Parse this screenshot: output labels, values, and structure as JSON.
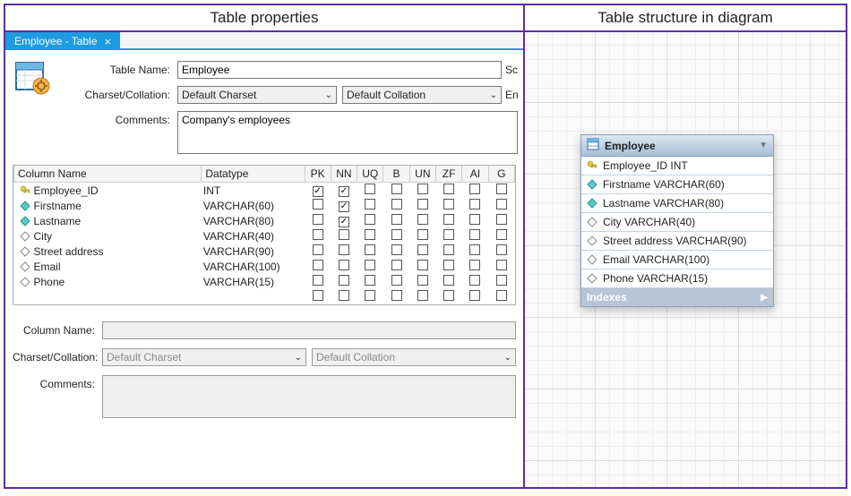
{
  "headings": {
    "left": "Table properties",
    "right": "Table structure in diagram"
  },
  "tab": {
    "label": "Employee - Table"
  },
  "props": {
    "table_name_label": "Table Name:",
    "table_name_value": "Employee",
    "extra1": "Sc",
    "charset_label": "Charset/Collation:",
    "charset_value": "Default Charset",
    "collation_value": "Default Collation",
    "extra2": "En",
    "comments_label": "Comments:",
    "comments_value": "Company's employees"
  },
  "cols": {
    "headers": {
      "name": "Column Name",
      "datatype": "Datatype",
      "pk": "PK",
      "nn": "NN",
      "uq": "UQ",
      "b": "B",
      "un": "UN",
      "zf": "ZF",
      "ai": "AI",
      "g": "G"
    },
    "rows": [
      {
        "icon": "key",
        "name": "Employee_ID",
        "datatype": "INT",
        "pk": true,
        "nn": true,
        "uq": false,
        "b": false,
        "un": false,
        "zf": false,
        "ai": false,
        "g": false
      },
      {
        "icon": "dia-filled",
        "name": "Firstname",
        "datatype": "VARCHAR(60)",
        "pk": false,
        "nn": true,
        "uq": false,
        "b": false,
        "un": false,
        "zf": false,
        "ai": false,
        "g": false
      },
      {
        "icon": "dia-filled",
        "name": "Lastname",
        "datatype": "VARCHAR(80)",
        "pk": false,
        "nn": true,
        "uq": false,
        "b": false,
        "un": false,
        "zf": false,
        "ai": false,
        "g": false
      },
      {
        "icon": "dia-open",
        "name": "City",
        "datatype": "VARCHAR(40)",
        "pk": false,
        "nn": false,
        "uq": false,
        "b": false,
        "un": false,
        "zf": false,
        "ai": false,
        "g": false
      },
      {
        "icon": "dia-open",
        "name": "Street address",
        "datatype": "VARCHAR(90)",
        "pk": false,
        "nn": false,
        "uq": false,
        "b": false,
        "un": false,
        "zf": false,
        "ai": false,
        "g": false
      },
      {
        "icon": "dia-open",
        "name": "Email",
        "datatype": "VARCHAR(100)",
        "pk": false,
        "nn": false,
        "uq": false,
        "b": false,
        "un": false,
        "zf": false,
        "ai": false,
        "g": false
      },
      {
        "icon": "dia-open",
        "name": "Phone",
        "datatype": "VARCHAR(15)",
        "pk": false,
        "nn": false,
        "uq": false,
        "b": false,
        "un": false,
        "zf": false,
        "ai": false,
        "g": false
      }
    ]
  },
  "col_detail": {
    "name_label": "Column Name:",
    "name_value": "",
    "charset_label": "Charset/Collation:",
    "charset_value": "Default Charset",
    "collation_value": "Default Collation",
    "comments_label": "Comments:",
    "comments_value": ""
  },
  "diagram": {
    "title": "Employee",
    "rows": [
      {
        "icon": "key",
        "text": "Employee_ID INT"
      },
      {
        "icon": "dia-filled",
        "text": "Firstname VARCHAR(60)"
      },
      {
        "icon": "dia-filled",
        "text": "Lastname VARCHAR(80)"
      },
      {
        "icon": "dia-open",
        "text": "City VARCHAR(40)"
      },
      {
        "icon": "dia-open",
        "text": "Street address VARCHAR(90)"
      },
      {
        "icon": "dia-open",
        "text": "Email VARCHAR(100)"
      },
      {
        "icon": "dia-open",
        "text": "Phone VARCHAR(15)"
      }
    ],
    "footer": "Indexes"
  }
}
